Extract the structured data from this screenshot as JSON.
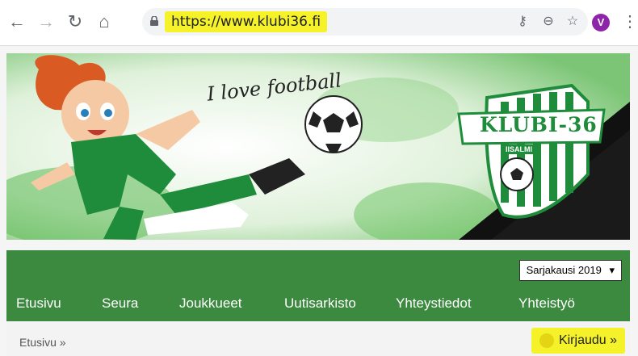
{
  "browser": {
    "url": "https://www.klubi36.fi",
    "avatar_letter": "V"
  },
  "banner": {
    "tagline": "I love football",
    "logo_title": "KLUBI-36",
    "logo_subtitle": "IISALMI"
  },
  "season_select": {
    "selected": "Sarjakausi 2019",
    "arrow": "▾"
  },
  "nav": {
    "items": [
      {
        "label": "Etusivu"
      },
      {
        "label": "Seura"
      },
      {
        "label": "Joukkueet"
      },
      {
        "label": "Uutisarkisto"
      },
      {
        "label": "Yhteystiedot"
      },
      {
        "label": "Yhteistyö"
      }
    ]
  },
  "breadcrumb": {
    "text": "Etusivu »"
  },
  "login": {
    "label": "Kirjaudu »"
  },
  "colors": {
    "brand_green": "#3b8a3f",
    "highlight": "#f5f22a",
    "avatar": "#8e24aa"
  }
}
